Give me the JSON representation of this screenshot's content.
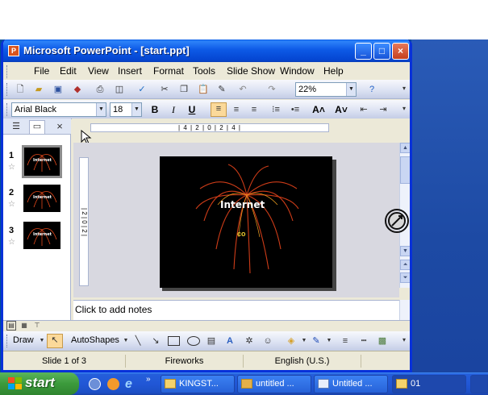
{
  "window": {
    "title": "Microsoft PowerPoint - [start.ppt]",
    "app_icon": "P",
    "caption": {
      "minimize": "_",
      "maximize": "□",
      "close": "×"
    }
  },
  "menu": [
    "File",
    "Edit",
    "View",
    "Insert",
    "Format",
    "Tools",
    "Slide Show",
    "Window",
    "Help"
  ],
  "standard_toolbar": {
    "icons": [
      "new-icon",
      "open-icon",
      "save-icon",
      "permission-icon",
      "print-icon",
      "print-preview-icon",
      "spelling-icon",
      "cut-icon",
      "copy-icon",
      "paste-icon",
      "format-painter-icon",
      "undo-icon",
      "redo-icon",
      "help-icon"
    ],
    "zoom": "22%"
  },
  "formatting_toolbar": {
    "font": "Arial Black",
    "size": "18",
    "bold": "B",
    "italic": "I",
    "underline": "U",
    "increase_font": "A˄",
    "decrease_font": "A˅"
  },
  "left_panel": {
    "close": "×",
    "thumbnails": [
      {
        "num": "1",
        "title": "Internet"
      },
      {
        "num": "2",
        "title": "Internet"
      },
      {
        "num": "3",
        "title": "Internet"
      }
    ]
  },
  "ruler_h": "| 4 | 2 | 0 | 2 | 4 |",
  "ruler_v": "| 2 | 0 | 2 |",
  "slide": {
    "title": "Internet",
    "subtitle": "co"
  },
  "notes": {
    "placeholder": "Click to add notes"
  },
  "drawing_toolbar": {
    "draw": "Draw",
    "autoshapes": "AutoShapes"
  },
  "status": {
    "slide": "Slide 1 of 3",
    "design": "Fireworks",
    "language": "English (U.S.)"
  },
  "taskbar": {
    "start": "start",
    "tasks": [
      {
        "label": "KINGST..."
      },
      {
        "label": "untitled ..."
      },
      {
        "label": "Untitled ..."
      },
      {
        "label": "01"
      }
    ]
  },
  "colors": {
    "title_bar": "#0a5fe8",
    "taskbar": "#245edb",
    "start_green": "#3c9a3c",
    "slide_bg": "#000000",
    "subtitle": "#e8c72e"
  }
}
